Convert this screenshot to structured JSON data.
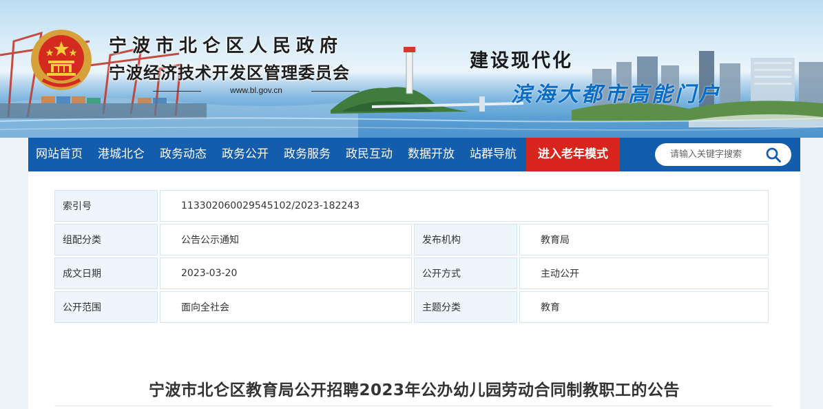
{
  "header": {
    "title": "宁波市北仑区人民政府",
    "subtitle": "宁波经济技术开发区管理委员会",
    "url": "www.bl.gov.cn",
    "slogan_1": "建设现代化",
    "slogan_2": "滨海大都市高能门户"
  },
  "nav": {
    "items": [
      "网站首页",
      "港城北仑",
      "政务动态",
      "政务公开",
      "政务服务",
      "政民互动",
      "数据开放",
      "站群导航"
    ],
    "elder_mode": "进入老年模式",
    "search_placeholder": "请输入关键字搜索"
  },
  "meta": {
    "index_label": "索引号",
    "index_value": "113302060029545102/2023-182243",
    "category_label": "组配分类",
    "category_value": "公告公示通知",
    "publisher_label": "发布机构",
    "publisher_value": "教育局",
    "date_label": "成文日期",
    "date_value": "2023-03-20",
    "method_label": "公开方式",
    "method_value": "主动公开",
    "scope_label": "公开范围",
    "scope_value": "面向全社会",
    "topic_label": "主题分类",
    "topic_value": "教育"
  },
  "article": {
    "title": "宁波市北仑区教育局公开招聘2023年公办幼儿园劳动合同制教职工的公告"
  },
  "colors": {
    "nav_bg": "#145dac",
    "elder_bg": "#d7251d",
    "meta_label_bg": "#eef5fc",
    "meta_border": "#d4e4f2"
  }
}
